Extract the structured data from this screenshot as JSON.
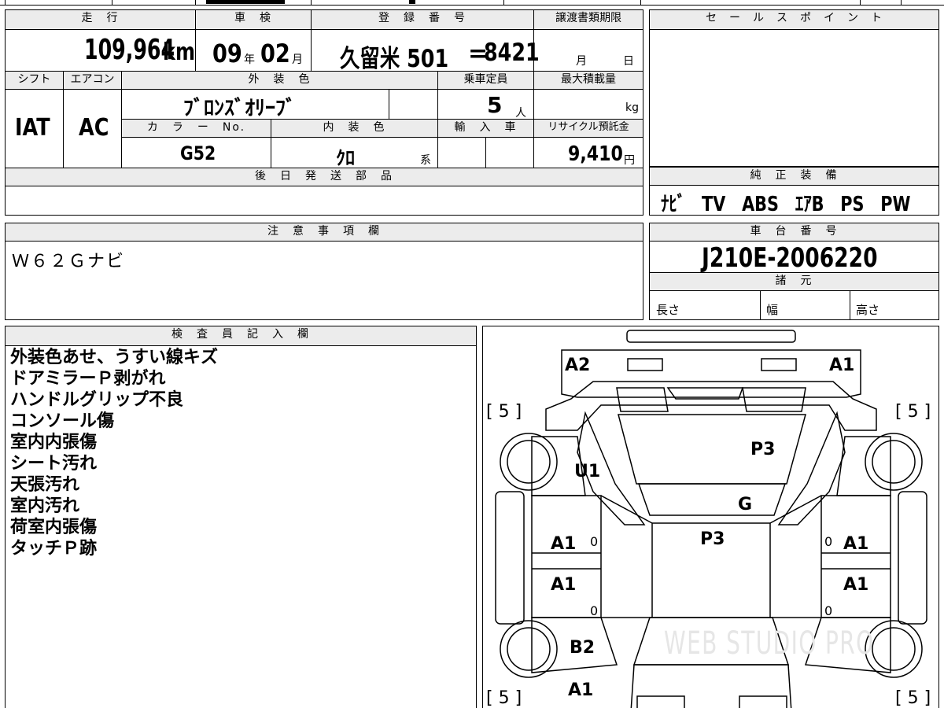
{
  "top_cut": [
    "",
    "",
    "",
    "",
    "",
    ""
  ],
  "vehicle": {
    "mileage_header": "走　行",
    "mileage": "109,964",
    "mileage_unit": "km",
    "inspection_header": "車　検",
    "inspection_year": "09",
    "inspection_year_unit": "年",
    "inspection_month": "02",
    "inspection_month_unit": "月",
    "registration_header": "登　録　番　号",
    "registration": "久留米 501",
    "registration_mark": "=",
    "registration_no": "8421",
    "transfer_header": "譲渡書類期限",
    "transfer_month": "月",
    "transfer_day": "日",
    "shift_header": "シフト",
    "shift": "IAT",
    "ac_header": "エアコン",
    "ac": "AC",
    "exterior_header": "外　装　色",
    "exterior": "ﾌﾞﾛﾝｽﾞｵﾘｰﾌﾞ",
    "capacity_header": "乗車定員",
    "capacity": "5",
    "capacity_unit": "人",
    "max_load_header": "最大積載量",
    "max_load_unit": "kg",
    "color_no_header": "カ　ラ　ー　No.",
    "color_no": "G52",
    "interior_header": "内　装　色",
    "interior": "ｸﾛ",
    "interior_unit": "系",
    "import_header": "輸　入　車",
    "recycle_header": "リサイクル預託金",
    "recycle": "9,410",
    "recycle_unit": "円",
    "later_parts_header": "後　日　発　送　部　品"
  },
  "sales_point": {
    "header": "セ　ー　ル　ス　ポ　イ　ン　ト"
  },
  "equipment": {
    "header": "純　正　装　備",
    "items": "ﾅﾋﾞ　TV　ABS　ｴｱB　PS　PW"
  },
  "notes": {
    "header": "注　意　事　項　欄",
    "text": "Ｗ６２Ｇナビ"
  },
  "chassis": {
    "header": "車　台　番　号",
    "number": "J210E-2006220",
    "spec_header": "諸　元",
    "length": "長さ",
    "width": "幅",
    "height": "高さ"
  },
  "inspector": {
    "header": "検　査　員　記　入　欄",
    "lines": [
      "外装色あせ、うすい線キズ",
      "ドアミラーＰ剥がれ",
      "ハンドルグリップ不良",
      "コンソール傷",
      "室内内張傷",
      "シート汚れ",
      "天張汚れ",
      "室内汚れ",
      "荷室内張傷",
      "タッチＰ跡"
    ]
  },
  "diagram": {
    "labels": [
      "A2",
      "A1",
      "P3",
      "U1",
      "G",
      "P3",
      "A1",
      "A1",
      "A1",
      "A1",
      "B2",
      "A1"
    ],
    "tire_brackets": [
      "[ 5 ]",
      "[ 5 ]",
      "[ 5 ]",
      "[ 5 ]"
    ],
    "zeros": [
      "0",
      "0",
      "0",
      "0"
    ],
    "watermark": "WEB STUDIO PRO"
  }
}
